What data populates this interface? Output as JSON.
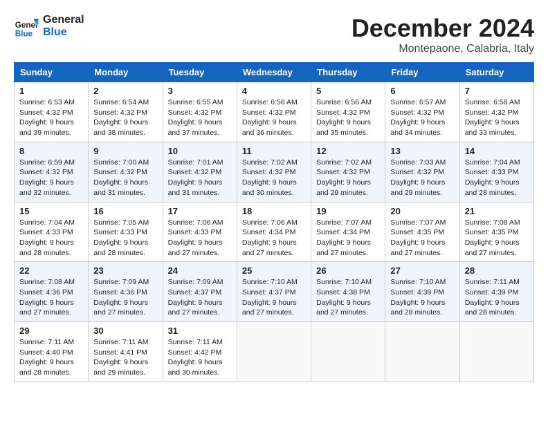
{
  "header": {
    "logo_line1": "General",
    "logo_line2": "Blue",
    "month": "December 2024",
    "location": "Montepaone, Calabria, Italy"
  },
  "weekdays": [
    "Sunday",
    "Monday",
    "Tuesday",
    "Wednesday",
    "Thursday",
    "Friday",
    "Saturday"
  ],
  "weeks": [
    [
      {
        "day": 1,
        "sunrise": "6:53 AM",
        "sunset": "4:32 PM",
        "daylight": "9 hours and 39 minutes."
      },
      {
        "day": 2,
        "sunrise": "6:54 AM",
        "sunset": "4:32 PM",
        "daylight": "9 hours and 38 minutes."
      },
      {
        "day": 3,
        "sunrise": "6:55 AM",
        "sunset": "4:32 PM",
        "daylight": "9 hours and 37 minutes."
      },
      {
        "day": 4,
        "sunrise": "6:56 AM",
        "sunset": "4:32 PM",
        "daylight": "9 hours and 36 minutes."
      },
      {
        "day": 5,
        "sunrise": "6:56 AM",
        "sunset": "4:32 PM",
        "daylight": "9 hours and 35 minutes."
      },
      {
        "day": 6,
        "sunrise": "6:57 AM",
        "sunset": "4:32 PM",
        "daylight": "9 hours and 34 minutes."
      },
      {
        "day": 7,
        "sunrise": "6:58 AM",
        "sunset": "4:32 PM",
        "daylight": "9 hours and 33 minutes."
      }
    ],
    [
      {
        "day": 8,
        "sunrise": "6:59 AM",
        "sunset": "4:32 PM",
        "daylight": "9 hours and 32 minutes."
      },
      {
        "day": 9,
        "sunrise": "7:00 AM",
        "sunset": "4:32 PM",
        "daylight": "9 hours and 31 minutes."
      },
      {
        "day": 10,
        "sunrise": "7:01 AM",
        "sunset": "4:32 PM",
        "daylight": "9 hours and 31 minutes."
      },
      {
        "day": 11,
        "sunrise": "7:02 AM",
        "sunset": "4:32 PM",
        "daylight": "9 hours and 30 minutes."
      },
      {
        "day": 12,
        "sunrise": "7:02 AM",
        "sunset": "4:32 PM",
        "daylight": "9 hours and 29 minutes."
      },
      {
        "day": 13,
        "sunrise": "7:03 AM",
        "sunset": "4:32 PM",
        "daylight": "9 hours and 29 minutes."
      },
      {
        "day": 14,
        "sunrise": "7:04 AM",
        "sunset": "4:33 PM",
        "daylight": "9 hours and 28 minutes."
      }
    ],
    [
      {
        "day": 15,
        "sunrise": "7:04 AM",
        "sunset": "4:33 PM",
        "daylight": "9 hours and 28 minutes."
      },
      {
        "day": 16,
        "sunrise": "7:05 AM",
        "sunset": "4:33 PM",
        "daylight": "9 hours and 28 minutes."
      },
      {
        "day": 17,
        "sunrise": "7:06 AM",
        "sunset": "4:33 PM",
        "daylight": "9 hours and 27 minutes."
      },
      {
        "day": 18,
        "sunrise": "7:06 AM",
        "sunset": "4:34 PM",
        "daylight": "9 hours and 27 minutes."
      },
      {
        "day": 19,
        "sunrise": "7:07 AM",
        "sunset": "4:34 PM",
        "daylight": "9 hours and 27 minutes."
      },
      {
        "day": 20,
        "sunrise": "7:07 AM",
        "sunset": "4:35 PM",
        "daylight": "9 hours and 27 minutes."
      },
      {
        "day": 21,
        "sunrise": "7:08 AM",
        "sunset": "4:35 PM",
        "daylight": "9 hours and 27 minutes."
      }
    ],
    [
      {
        "day": 22,
        "sunrise": "7:08 AM",
        "sunset": "4:36 PM",
        "daylight": "9 hours and 27 minutes."
      },
      {
        "day": 23,
        "sunrise": "7:09 AM",
        "sunset": "4:36 PM",
        "daylight": "9 hours and 27 minutes."
      },
      {
        "day": 24,
        "sunrise": "7:09 AM",
        "sunset": "4:37 PM",
        "daylight": "9 hours and 27 minutes."
      },
      {
        "day": 25,
        "sunrise": "7:10 AM",
        "sunset": "4:37 PM",
        "daylight": "9 hours and 27 minutes."
      },
      {
        "day": 26,
        "sunrise": "7:10 AM",
        "sunset": "4:38 PM",
        "daylight": "9 hours and 27 minutes."
      },
      {
        "day": 27,
        "sunrise": "7:10 AM",
        "sunset": "4:39 PM",
        "daylight": "9 hours and 28 minutes."
      },
      {
        "day": 28,
        "sunrise": "7:11 AM",
        "sunset": "4:39 PM",
        "daylight": "9 hours and 28 minutes."
      }
    ],
    [
      {
        "day": 29,
        "sunrise": "7:11 AM",
        "sunset": "4:40 PM",
        "daylight": "9 hours and 28 minutes."
      },
      {
        "day": 30,
        "sunrise": "7:11 AM",
        "sunset": "4:41 PM",
        "daylight": "9 hours and 29 minutes."
      },
      {
        "day": 31,
        "sunrise": "7:11 AM",
        "sunset": "4:42 PM",
        "daylight": "9 hours and 30 minutes."
      },
      null,
      null,
      null,
      null
    ]
  ]
}
